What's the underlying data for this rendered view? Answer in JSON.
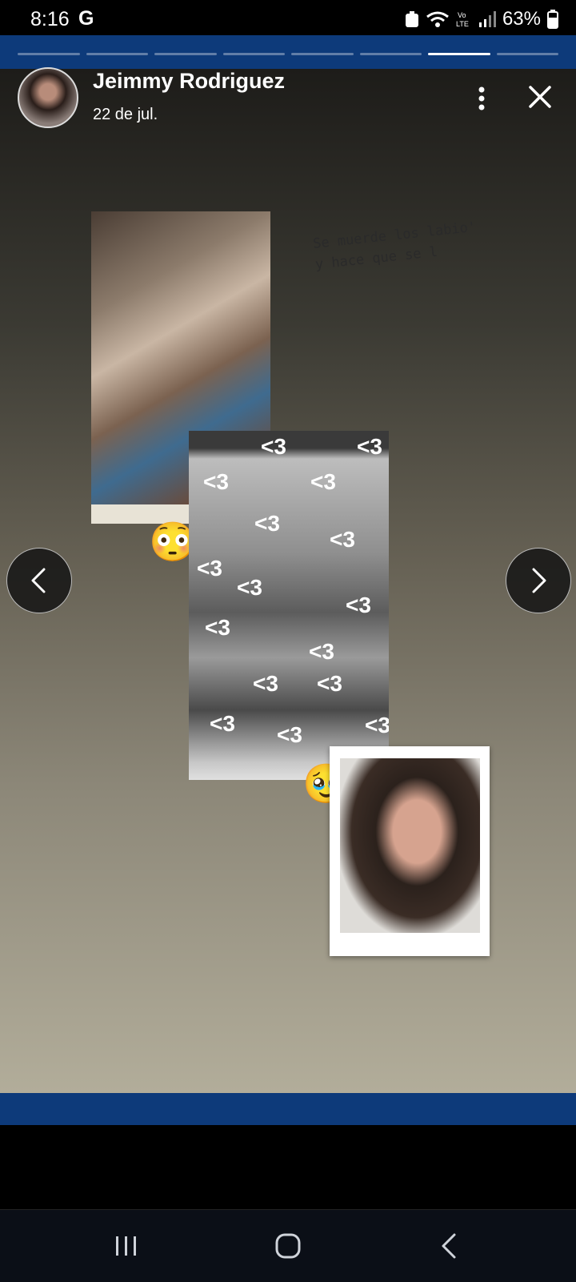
{
  "status_bar": {
    "time": "8:16",
    "google_mark": "G",
    "battery": "63%"
  },
  "story": {
    "progress_segments": 8,
    "active_segment": 7,
    "author": "Jeimmy Rodriguez",
    "date": "22 de jul.",
    "caption_line1": "Se muerde los labio'",
    "caption_line2": "y hace que se l"
  },
  "colors": {
    "band": "#0d3a7a",
    "background_top": "#1d1c19",
    "background_bottom": "#b2ad9a"
  },
  "emojis": {
    "flushed": "😳",
    "pleading": "🥹"
  },
  "icons": {
    "more": "more-vertical-icon",
    "close": "close-icon",
    "prev": "chevron-left-icon",
    "next": "chevron-right-icon",
    "recents": "recents-icon",
    "home": "home-icon",
    "back": "back-icon"
  }
}
